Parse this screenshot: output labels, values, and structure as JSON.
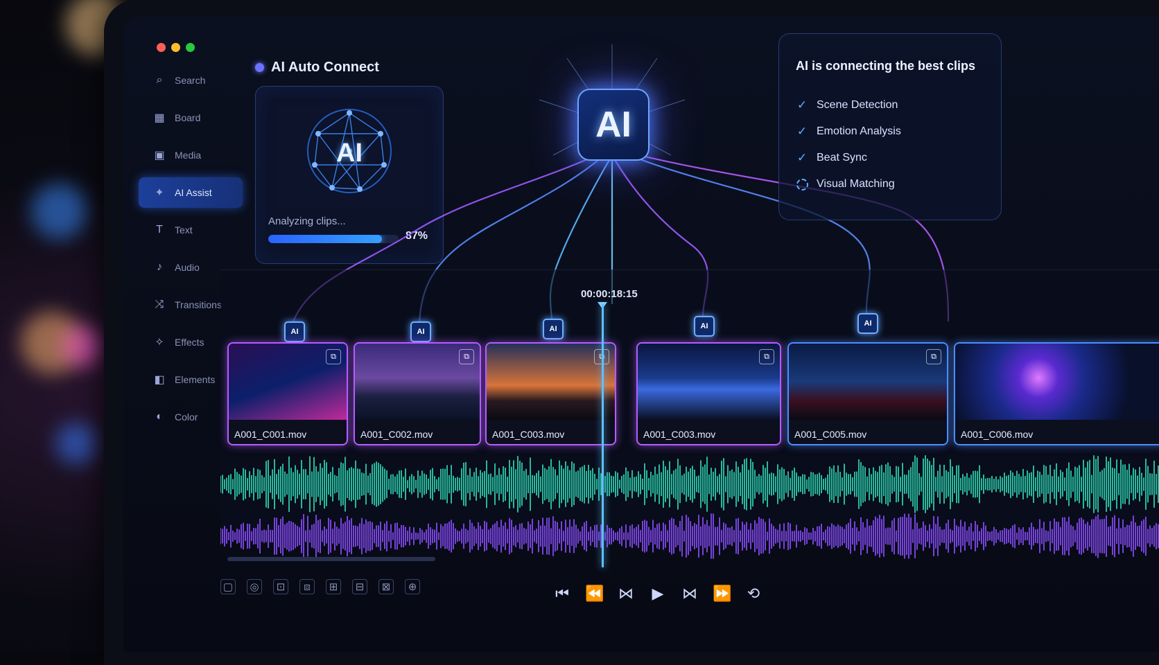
{
  "panel": {
    "title": "AI Auto Connect"
  },
  "sidebar": {
    "items": [
      {
        "label": "Search",
        "icon": "search-icon"
      },
      {
        "label": "Board",
        "icon": "board-icon"
      },
      {
        "label": "Media",
        "icon": "media-icon"
      },
      {
        "label": "AI Assist",
        "icon": "ai-assist-icon",
        "active": true
      },
      {
        "label": "Text",
        "icon": "text-icon"
      },
      {
        "label": "Audio",
        "icon": "audio-icon"
      },
      {
        "label": "Transitions",
        "icon": "transitions-icon"
      },
      {
        "label": "Effects",
        "icon": "effects-icon"
      },
      {
        "label": "Elements",
        "icon": "elements-icon"
      },
      {
        "label": "Color",
        "icon": "color-icon"
      }
    ]
  },
  "analysis": {
    "brain_label": "AI",
    "status": "Analyzing clips...",
    "progress_pct": 87,
    "progress_text": "87%"
  },
  "center": {
    "chip_label": "AI"
  },
  "status_card": {
    "title": "AI is connecting the best clips",
    "steps": [
      {
        "label": "Scene Detection",
        "done": true
      },
      {
        "label": "Emotion Analysis",
        "done": true
      },
      {
        "label": "Beat Sync",
        "done": true
      },
      {
        "label": "Visual Matching",
        "done": false
      }
    ]
  },
  "timeline": {
    "playhead_time": "00:00:18:15",
    "clips": [
      {
        "name": "A001_C001.mov",
        "badge": "AI"
      },
      {
        "name": "A001_C002.mov",
        "badge": "AI"
      },
      {
        "name": "A001_C003.mov",
        "badge": "AI"
      },
      {
        "name": "A001_C003.mov",
        "badge": "AI"
      },
      {
        "name": "A001_C005.mov",
        "badge": "AI"
      },
      {
        "name": "A001_C006.mov",
        "badge": ""
      }
    ]
  },
  "colors": {
    "accent_blue": "#4c8dff",
    "accent_purple": "#b65cff",
    "audio_teal": "#2fd8b4",
    "audio_purple": "#8a4dff"
  }
}
